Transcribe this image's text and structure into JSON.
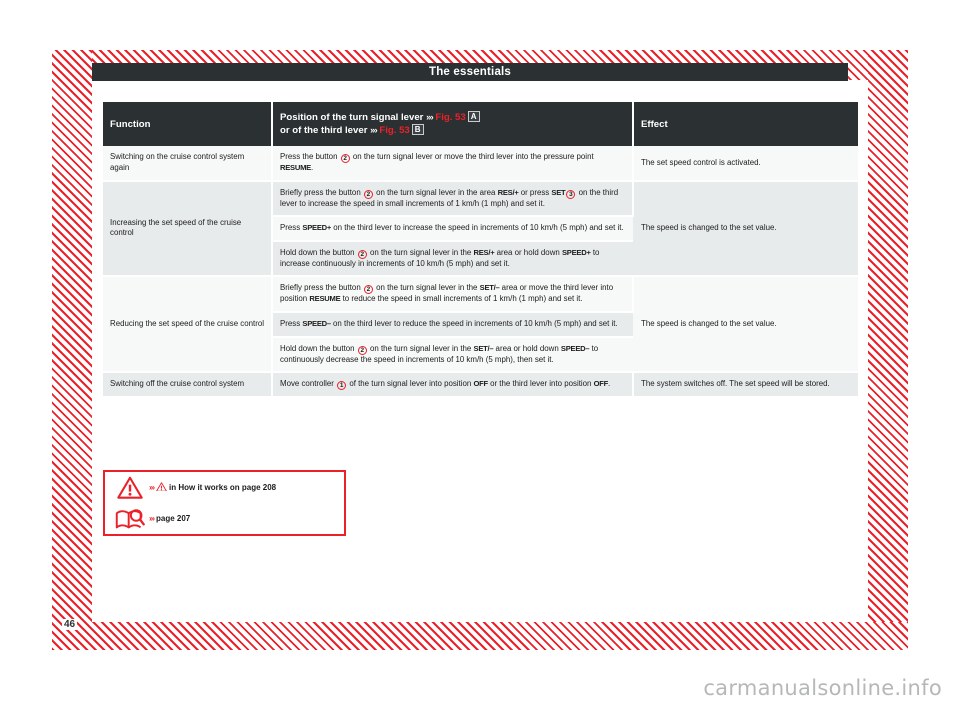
{
  "document": {
    "running_title": "The essentials",
    "page_number": "46",
    "watermark": "carmanualsonline.info"
  },
  "table": {
    "headers": {
      "function": "Function",
      "position_line1_pre": "Position of the turn signal lever",
      "position_line1_chev": "›››",
      "position_line1_ref": "Fig. 53",
      "position_line1_marker": "A",
      "position_line2_pre": "or of the third lever",
      "position_line2_chev": "›››",
      "position_line2_ref": "Fig. 53",
      "position_line2_marker": "B",
      "effect": "Effect"
    },
    "rows": [
      {
        "function": "Switching on the cruise control system again",
        "effect": "The set speed control is activated.",
        "steps": [
          {
            "shade": "light",
            "parts": [
              {
                "t": "text",
                "v": "Press the button "
              },
              {
                "t": "cnum",
                "v": "2"
              },
              {
                "t": "text",
                "v": " on the turn signal lever or move the third lever into the pressure point "
              },
              {
                "t": "lbl",
                "v": "RESUME"
              },
              {
                "t": "text",
                "v": "."
              }
            ]
          }
        ]
      },
      {
        "function": "Increasing the set speed of the cruise control",
        "effect": "The speed is changed to the set value.",
        "steps": [
          {
            "shade": "dark",
            "parts": [
              {
                "t": "text",
                "v": "Briefly press the button "
              },
              {
                "t": "cnum",
                "v": "2"
              },
              {
                "t": "text",
                "v": " on the turn signal lever in the area "
              },
              {
                "t": "lbl",
                "v": "RES/+"
              },
              {
                "t": "text",
                "v": " or press "
              },
              {
                "t": "lbl",
                "v": "SET"
              },
              {
                "t": "cnum",
                "v": "3"
              },
              {
                "t": "text",
                "v": " on the third lever to increase the speed in small increments of 1 km/h (1 mph) and set it."
              }
            ]
          },
          {
            "shade": "light",
            "parts": [
              {
                "t": "text",
                "v": "Press "
              },
              {
                "t": "lbl",
                "v": "SPEED+"
              },
              {
                "t": "text",
                "v": " on the third lever to increase the speed in increments of 10 km/h (5 mph) and set it."
              }
            ]
          },
          {
            "shade": "dark",
            "parts": [
              {
                "t": "text",
                "v": "Hold down the button "
              },
              {
                "t": "cnum",
                "v": "2"
              },
              {
                "t": "text",
                "v": " on the turn signal lever in the "
              },
              {
                "t": "lbl",
                "v": "RES/+"
              },
              {
                "t": "text",
                "v": " area or hold down "
              },
              {
                "t": "lbl",
                "v": "SPEED+"
              },
              {
                "t": "text",
                "v": " to increase continuously in increments of 10 km/h (5 mph) and set it."
              }
            ]
          }
        ]
      },
      {
        "function": "Reducing the set speed of the cruise control",
        "effect": "The speed is changed to the set value.",
        "steps": [
          {
            "shade": "light",
            "parts": [
              {
                "t": "text",
                "v": "Briefly press the button "
              },
              {
                "t": "cnum",
                "v": "2"
              },
              {
                "t": "text",
                "v": " on the turn signal lever in the "
              },
              {
                "t": "lbl",
                "v": "SET/–"
              },
              {
                "t": "text",
                "v": " area or move the third lever into position "
              },
              {
                "t": "lbl",
                "v": "RESUME"
              },
              {
                "t": "text",
                "v": " to reduce the speed in small increments of 1 km/h (1 mph) and set it."
              }
            ]
          },
          {
            "shade": "dark",
            "parts": [
              {
                "t": "text",
                "v": "Press "
              },
              {
                "t": "lbl",
                "v": "SPEED–"
              },
              {
                "t": "text",
                "v": " on the third lever to reduce the speed in increments of 10 km/h (5 mph) and set it."
              }
            ]
          },
          {
            "shade": "light",
            "parts": [
              {
                "t": "text",
                "v": "Hold down the button "
              },
              {
                "t": "cnum",
                "v": "2"
              },
              {
                "t": "text",
                "v": " on the turn signal lever in the "
              },
              {
                "t": "lbl",
                "v": "SET/–"
              },
              {
                "t": "text",
                "v": " area or hold down "
              },
              {
                "t": "lbl",
                "v": "SPEED–"
              },
              {
                "t": "text",
                "v": " to continuously decrease the speed in increments of 10 km/h (5 mph), then set it."
              }
            ]
          }
        ]
      },
      {
        "function": "Switching off the cruise control system",
        "effect": "The system switches off. The set speed will be stored.",
        "steps": [
          {
            "shade": "dark",
            "parts": [
              {
                "t": "text",
                "v": "Move controller "
              },
              {
                "t": "cnum",
                "v": "1"
              },
              {
                "t": "text",
                "v": " of the turn signal lever into position "
              },
              {
                "t": "lbl",
                "v": "OFF"
              },
              {
                "t": "text",
                "v": " or the third lever into position "
              },
              {
                "t": "lbl",
                "v": "OFF"
              },
              {
                "t": "text",
                "v": "."
              }
            ]
          }
        ]
      }
    ]
  },
  "note_box": {
    "rows": [
      {
        "icon": "warning-triangle-icon",
        "chev": "›››",
        "inline_icon": "warning-triangle-icon",
        "text": "in How it works on page 208"
      },
      {
        "icon": "book-magnifier-icon",
        "chev": "›››",
        "inline_icon": null,
        "text": "page 207"
      }
    ]
  },
  "colors": {
    "accent_red": "#ec2029",
    "header_dark": "#2b3133",
    "row_light": "#f7f8f8",
    "row_dark": "#e8ebec"
  }
}
